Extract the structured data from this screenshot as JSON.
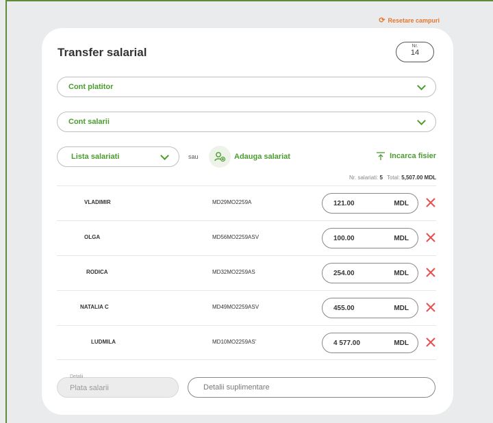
{
  "reset": {
    "label": "Resetare campuri"
  },
  "form": {
    "title": "Transfer salarial",
    "nr_label": "Nr.",
    "nr_value": "14",
    "payer_account": "Cont platitor",
    "salary_account": "Cont salarii",
    "employee_list": "Lista salariati",
    "or_label": "sau",
    "add_employee": "Adauga salariat",
    "upload_file": "Incarca fisier"
  },
  "summary": {
    "count_label": "Nr. salariati:",
    "count_value": "5",
    "total_label": "Total:",
    "total_value": "5,507.00 MDL"
  },
  "employees": [
    {
      "name": "VLADIMIR",
      "iban": "MD29MO2259A",
      "amount": "121.00",
      "currency": "MDL"
    },
    {
      "name": "OLGA",
      "iban": "MD56MO2259ASV",
      "amount": "100.00",
      "currency": "MDL"
    },
    {
      "name": "RODICA",
      "iban": "MD32MO2259AS",
      "amount": "254.00",
      "currency": "MDL"
    },
    {
      "name": "NATALIA C",
      "iban": "MD49MO2259ASV",
      "amount": "455.00",
      "currency": "MDL"
    },
    {
      "name": "LUDMILA",
      "iban": "MD10MO2259AS'",
      "amount": "4 577.00",
      "currency": "MDL"
    }
  ],
  "details": {
    "label": "Detalii",
    "value": "Plata salarii",
    "extra_placeholder": "Detalii suplimentare"
  },
  "colors": {
    "accent_green": "#4a9c2d",
    "reset_orange": "#e8772e",
    "delete_red": "#e84e4e"
  }
}
